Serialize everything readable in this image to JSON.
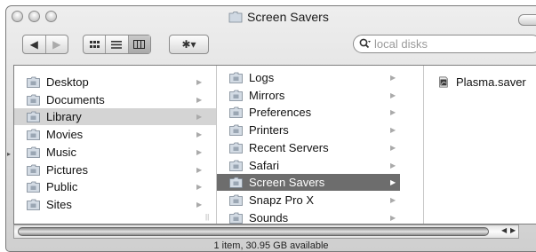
{
  "window": {
    "title": "Screen Savers"
  },
  "toolbar": {
    "view_icon": "icon-view",
    "list_view": "list-view",
    "column_view": "column-view",
    "action_glyph": "✱▾"
  },
  "search": {
    "placeholder": "local disks"
  },
  "column1": [
    {
      "label": "Desktop",
      "icon": "desktop-icon"
    },
    {
      "label": "Documents",
      "icon": "documents-icon"
    },
    {
      "label": "Library",
      "icon": "library-icon",
      "state": "selected-inactive"
    },
    {
      "label": "Movies",
      "icon": "movies-icon"
    },
    {
      "label": "Music",
      "icon": "music-icon"
    },
    {
      "label": "Pictures",
      "icon": "pictures-icon"
    },
    {
      "label": "Public",
      "icon": "public-icon"
    },
    {
      "label": "Sites",
      "icon": "sites-icon"
    }
  ],
  "column2": [
    {
      "label": "Logs"
    },
    {
      "label": "Mirrors"
    },
    {
      "label": "Preferences"
    },
    {
      "label": "Printers"
    },
    {
      "label": "Recent Servers"
    },
    {
      "label": "Safari"
    },
    {
      "label": "Screen Savers",
      "state": "selected"
    },
    {
      "label": "Snapz Pro X"
    },
    {
      "label": "Sounds"
    }
  ],
  "column3": [
    {
      "label": "Plasma.saver"
    }
  ],
  "status": {
    "text": "1 item, 30.95 GB available"
  }
}
